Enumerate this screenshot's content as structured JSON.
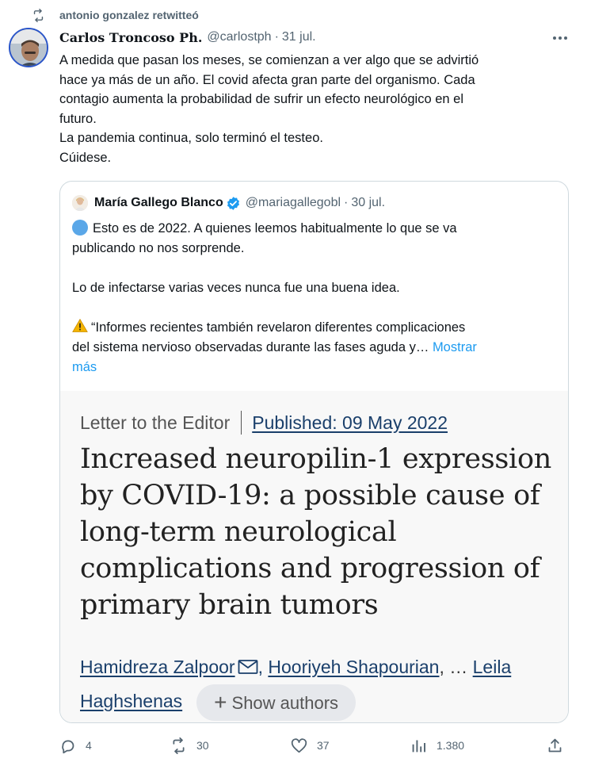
{
  "retweet": {
    "text": "antonio gonzalez retwitteó",
    "icon": "retweet-icon"
  },
  "tweet": {
    "author_name": "𝐂𝐚𝐫𝐥𝐨𝐬 𝐓𝐫𝐨𝐧𝐜𝐨𝐬𝐨 𝐏𝐡.",
    "handle": "@carlostph",
    "separator": "·",
    "date": "31 jul.",
    "more_icon": "more-icon",
    "text_lines": [
      "A medida que pasan los meses, se comienzan a ver algo que se advirtió",
      "hace ya más de un año.  El covid afecta gran parte del organismo. Cada",
      "contagio aumenta la probabilidad de sufrir un efecto neurológico en el",
      "futuro.",
      "La pandemia continua, solo terminó el testeo.",
      "Cúidese."
    ]
  },
  "quote": {
    "author_name": "María Gallego Blanco",
    "verified_icon": "verified-badge-icon",
    "handle": "@mariagallegobl",
    "separator": "·",
    "date": "30 jul.",
    "para1_line1": "Esto es de 2022. A quienes leemos habitualmente lo que se va",
    "para1_line2": "publicando no nos sorprende.",
    "para2": "Lo de infectarse varias veces nunca fue una buena idea.",
    "para3_line1": "“Informes recientes también revelaron diferentes complicaciones",
    "para3_line2": "del sistema nervioso observadas durante las fases aguda y…",
    "show_more_a": "Mostrar",
    "show_more_b": "más"
  },
  "card": {
    "category": "Letter to the Editor",
    "published": "Published: 09 May 2022",
    "title_lines": [
      "Increased neuropilin-1 expression",
      "by COVID-19: a possible cause of",
      "long-term neurological",
      "complications and progression of",
      "primary brain tumors"
    ],
    "author1": "Hamidreza Zalpoor",
    "author2": "Hooriyeh Shapourian",
    "sep_comma": ",",
    "ellipsis": ", …",
    "author3_a": "Leila",
    "author3_b": "Haghshenas",
    "show_authors_plus": "+",
    "show_authors": "Show authors"
  },
  "actions": {
    "replies": "4",
    "retweets": "30",
    "likes": "37",
    "views": "1.380"
  }
}
